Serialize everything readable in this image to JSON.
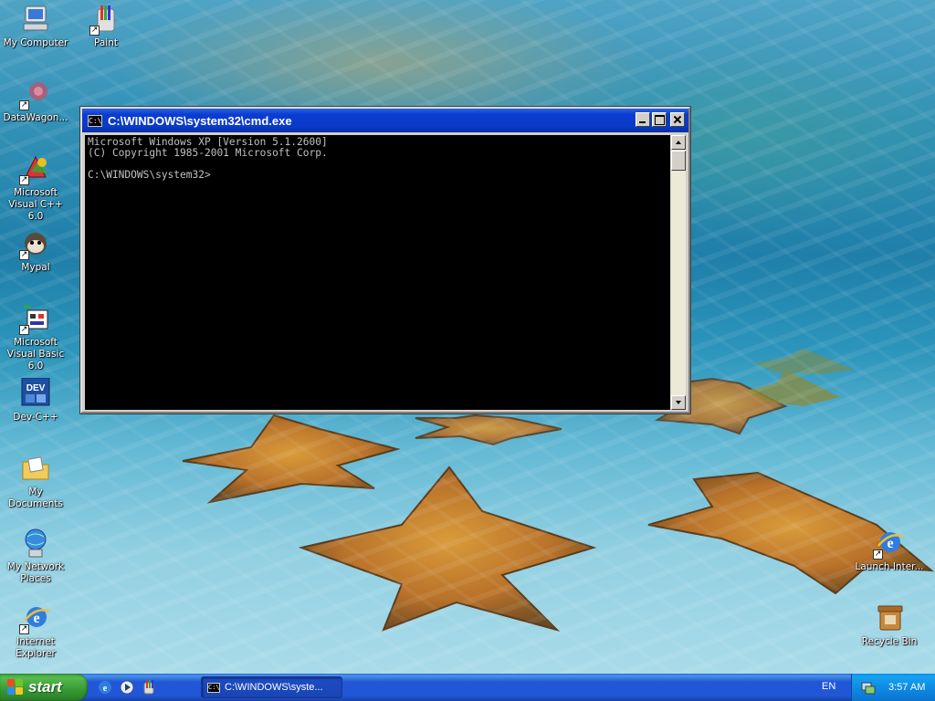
{
  "desktop": {
    "icons_left": [
      {
        "label": "My Computer",
        "icon": "my-computer-icon"
      },
      {
        "label": "DataWagon...",
        "icon": "datawagon-icon"
      },
      {
        "label": "Microsoft Visual C++ 6.0",
        "icon": "visual-cpp-icon"
      },
      {
        "label": "Mypal",
        "icon": "mypal-icon"
      },
      {
        "label": "Microsoft Visual Basic 6.0",
        "icon": "visual-basic-icon"
      },
      {
        "label": "Dev-C++",
        "icon": "dev-cpp-icon"
      },
      {
        "label": "My Documents",
        "icon": "my-documents-icon"
      },
      {
        "label": "My Network Places",
        "icon": "network-places-icon"
      },
      {
        "label": "Internet Explorer",
        "icon": "internet-explorer-icon"
      }
    ],
    "icon_paint": {
      "label": "Paint",
      "icon": "paint-icon"
    },
    "icon_launch": {
      "label": "Launch Inter...",
      "icon": "launch-internet-icon"
    },
    "icon_recycle": {
      "label": "Recycle Bin",
      "icon": "recycle-bin-icon"
    },
    "dev_badge": "DEV"
  },
  "cmd_window": {
    "title": "C:\\WINDOWS\\system32\\cmd.exe",
    "icon_text": "C:\\",
    "lines": [
      "Microsoft Windows XP [Version 5.1.2600]",
      "(C) Copyright 1985-2001 Microsoft Corp.",
      "",
      "C:\\WINDOWS\\system32>"
    ]
  },
  "taskbar": {
    "start_label": "start",
    "task_label": "C:\\WINDOWS\\syste...",
    "language": "EN",
    "clock": "3:57 AM",
    "colors": {
      "bar": "#2157d7",
      "start": "#379933",
      "tray": "#0f8ce4"
    }
  }
}
